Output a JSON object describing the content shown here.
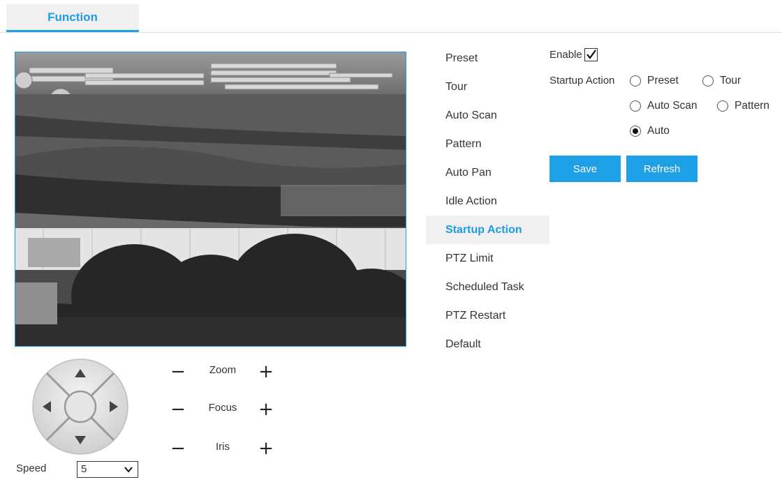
{
  "tabs": [
    {
      "label": "Function"
    }
  ],
  "ptz": {
    "speed_label": "Speed",
    "speed_value": "5",
    "controls": [
      {
        "label": "Zoom",
        "minus": "−",
        "plus": "+"
      },
      {
        "label": "Focus",
        "minus": "−",
        "plus": "+"
      },
      {
        "label": "Iris",
        "minus": "−",
        "plus": "+"
      }
    ]
  },
  "menu": {
    "items": [
      {
        "label": "Preset"
      },
      {
        "label": "Tour"
      },
      {
        "label": "Auto Scan"
      },
      {
        "label": "Pattern"
      },
      {
        "label": "Auto Pan"
      },
      {
        "label": "Idle Action"
      },
      {
        "label": "Startup Action"
      },
      {
        "label": "PTZ Limit"
      },
      {
        "label": "Scheduled Task"
      },
      {
        "label": "PTZ Restart"
      },
      {
        "label": "Default"
      }
    ],
    "active": "Startup Action"
  },
  "settings": {
    "enable_label": "Enable",
    "enable_checked": true,
    "startup_action_label": "Startup Action",
    "options": [
      {
        "label": "Preset",
        "checked": false
      },
      {
        "label": "Tour",
        "checked": false
      },
      {
        "label": "Auto Scan",
        "checked": false
      },
      {
        "label": "Pattern",
        "checked": false
      },
      {
        "label": "Auto",
        "checked": true
      }
    ],
    "save_label": "Save",
    "refresh_label": "Refresh"
  },
  "colors": {
    "accent": "#1ea0e6",
    "active_bg": "#f0f0f0"
  }
}
